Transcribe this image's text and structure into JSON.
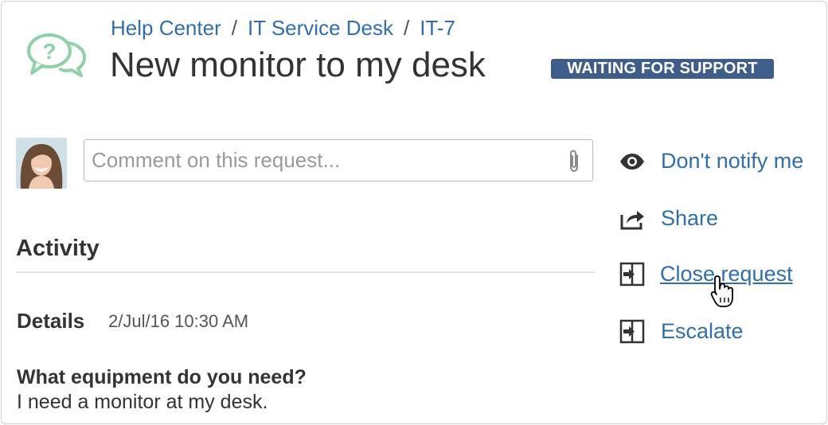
{
  "breadcrumb": {
    "items": [
      "Help Center",
      "IT Service Desk",
      "IT-7"
    ],
    "separator": "/"
  },
  "request": {
    "title": "New monitor to my desk",
    "status": "WAITING FOR SUPPORT"
  },
  "comment": {
    "placeholder": "Comment on this request...",
    "value": ""
  },
  "activity": {
    "heading": "Activity",
    "details_label": "Details",
    "details_date": "2/Jul/16 10:30 AM",
    "question": "What equipment do you need?",
    "answer": "I need a monitor at my desk."
  },
  "actions": [
    {
      "label": "Don't notify me",
      "icon": "eye-icon"
    },
    {
      "label": "Share",
      "icon": "share-icon"
    },
    {
      "label": "Close request",
      "icon": "close-request-icon"
    },
    {
      "label": "Escalate",
      "icon": "escalate-icon"
    }
  ],
  "colors": {
    "link": "#2e6fb4",
    "status_badge": "#3e5d8a",
    "logo": "#8fd1a9",
    "text": "#333333"
  }
}
